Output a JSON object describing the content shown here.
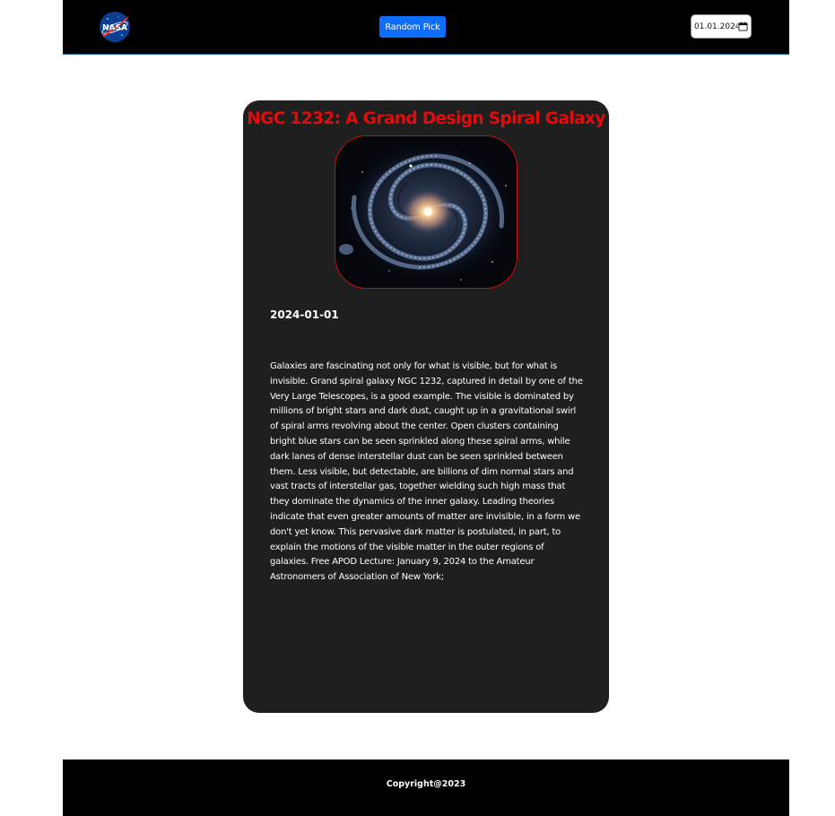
{
  "header": {
    "logo_icon": "nasa-logo",
    "logo_text": "NASA",
    "random_button_label": "Random Pick",
    "date_value": "01.01.2024",
    "calendar_icon": "calendar-icon",
    "accent_color": "#0d6efd",
    "background_color": "#000000"
  },
  "apod": {
    "title": "NGC 1232: A Grand Design Spiral Galaxy",
    "title_color": "#e30b0b",
    "image_subject": "spiral-galaxy-image",
    "date": "2024-01-01",
    "explanation": "Galaxies are fascinating not only for what is visible, but for what is invisible. Grand spiral galaxy NGC 1232, captured in detail by one of the Very Large Telescopes, is a good example. The visible is dominated by millions of bright stars and dark dust, caught up in a gravitational swirl of spiral arms revolving about the center. Open clusters containing bright blue stars can be seen sprinkled along these spiral arms, while dark lanes of dense interstellar dust can be seen sprinkled between them. Less visible, but detectable, are billions of dim normal stars and vast tracts of interstellar gas, together wielding such high mass that they dominate the dynamics of the inner galaxy. Leading theories indicate that even greater amounts of matter are invisible, in a form we don't yet know. This pervasive dark matter is postulated, in part, to explain the motions of the visible matter in the outer regions of galaxies. Free APOD Lecture: January 9, 2024 to the Amateur Astronomers of Association of New York;",
    "card_color": "#201f20"
  },
  "footer": {
    "copyright": "Copyright@2023"
  }
}
